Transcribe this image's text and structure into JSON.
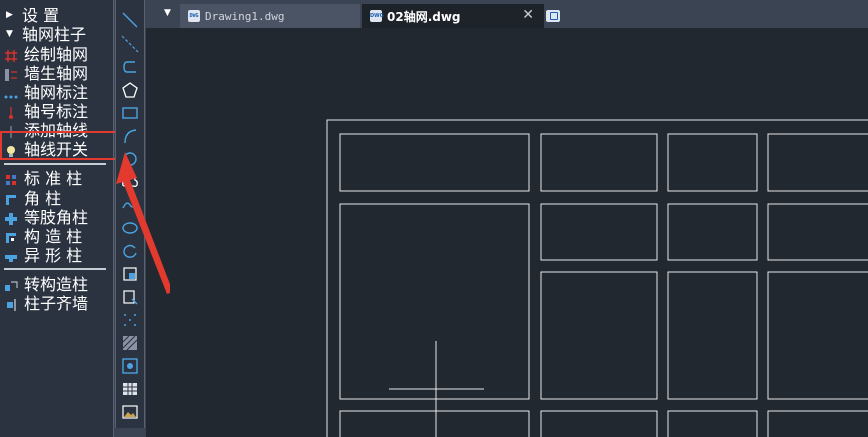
{
  "left_panel": {
    "sections": [
      {
        "label": "设    置",
        "expanded": false
      },
      {
        "label": "轴网柱子",
        "expanded": true
      }
    ],
    "items": [
      {
        "label": "绘制轴网",
        "icon": "grid-icon"
      },
      {
        "label": "墙生轴网",
        "icon": "wall-grid-icon"
      },
      {
        "label": "轴网标注",
        "icon": "dimension-icon"
      },
      {
        "label": "轴号标注",
        "icon": "axis-number-icon"
      },
      {
        "label": "添加轴线",
        "icon": "add-axis-icon"
      },
      {
        "label": "轴线开关",
        "icon": "bulb-icon"
      },
      {
        "label": "标 准 柱",
        "icon": "standard-column-icon"
      },
      {
        "label": "角       柱",
        "icon": "corner-column-icon"
      },
      {
        "label": "等肢角柱",
        "icon": "equal-leg-column-icon"
      },
      {
        "label": "构 造 柱",
        "icon": "structural-column-icon"
      },
      {
        "label": "异 形 柱",
        "icon": "special-column-icon"
      },
      {
        "label": "转构造柱",
        "icon": "convert-column-icon"
      },
      {
        "label": "柱子齐墙",
        "icon": "align-column-icon"
      }
    ],
    "highlighted_item": "轴线开关",
    "highlight_color": "#e23a2e"
  },
  "toolbar": {
    "tools": [
      "line-icon",
      "construction-line-icon",
      "polyline-icon",
      "polygon-icon",
      "rectangle-icon",
      "arc-icon",
      "circle-icon",
      "revision-cloud-icon",
      "spline-icon",
      "ellipse-icon",
      "ellipse-arc-icon",
      "insert-block-icon",
      "make-block-icon",
      "point-icon",
      "hatch-icon",
      "region-icon",
      "table-icon",
      "image-icon"
    ]
  },
  "tabs": [
    {
      "label": "Drawing1.dwg",
      "active": false,
      "icon": "dwg-file-icon",
      "icon_text": "DWG"
    },
    {
      "label": "02轴网.dwg",
      "active": true,
      "icon": "dwg-file-icon",
      "icon_text": "DWG",
      "close": "✕"
    }
  ],
  "colors": {
    "canvas_bg": "#212830",
    "panel_bg": "#2b3340",
    "line": "#e8e8e8",
    "annotation_red": "#e23a2e"
  }
}
